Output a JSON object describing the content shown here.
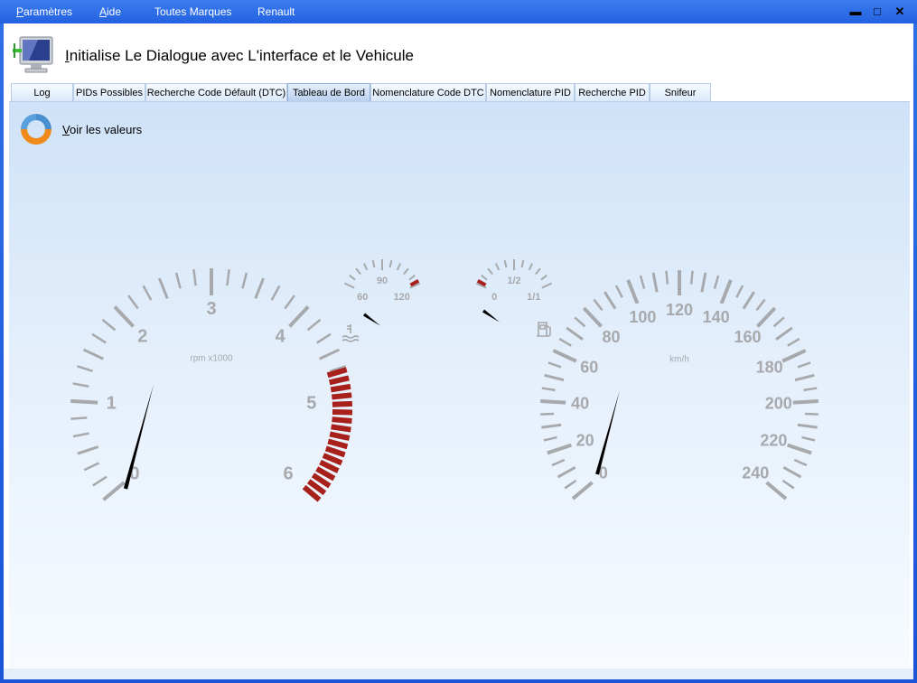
{
  "menu": {
    "items": [
      {
        "first": "P",
        "rest": "aramètres"
      },
      {
        "first": "A",
        "rest": "ide"
      },
      {
        "first": "",
        "rest": "Toutes Marques"
      },
      {
        "first": "",
        "rest": "Renault"
      }
    ]
  },
  "window_controls": {
    "minimize": "▬",
    "maximize": "□",
    "close": "✕"
  },
  "header": {
    "title_first": "I",
    "title_rest": "nitialise Le Dialogue avec L'interface et le Vehicule"
  },
  "tabs": [
    {
      "label": "Log"
    },
    {
      "label": "PIDs Possibles"
    },
    {
      "label": "Recherche Code Défault (DTC)"
    },
    {
      "label": "Tableau de Bord",
      "active": true
    },
    {
      "label": "Nomenclature Code DTC"
    },
    {
      "label": "Nomenclature PID"
    },
    {
      "label": "Recherche PID"
    },
    {
      "label": "Snifeur"
    }
  ],
  "panel": {
    "view_first": "V",
    "view_rest": "oir les valeurs"
  },
  "gauges": {
    "rpm": {
      "unit": "rpm x1000",
      "labels": [
        "0",
        "1",
        "2",
        "3",
        "4",
        "5",
        "6"
      ],
      "value": 0,
      "min": 0,
      "max": 6,
      "redline": 4.7
    },
    "temperature": {
      "labels": [
        "60",
        "90",
        "120"
      ],
      "value": 60,
      "min": 60,
      "max": 120,
      "icon": "coolant-temperature-icon"
    },
    "fuel": {
      "labels": [
        "0",
        "1/2",
        "1/1"
      ],
      "value": 0,
      "min": 0,
      "max": 1,
      "icon": "fuel-pump-icon"
    },
    "speed": {
      "unit": "km/h",
      "labels": [
        "0",
        "20",
        "40",
        "60",
        "80",
        "100",
        "120",
        "140",
        "160",
        "180",
        "200",
        "220",
        "240"
      ],
      "value": 0,
      "min": 0,
      "max": 240
    }
  },
  "colors": {
    "tick": "#a7a9ac",
    "redzone": "#a8201c",
    "needle": "#000000",
    "titlebar": "#2361e0"
  }
}
